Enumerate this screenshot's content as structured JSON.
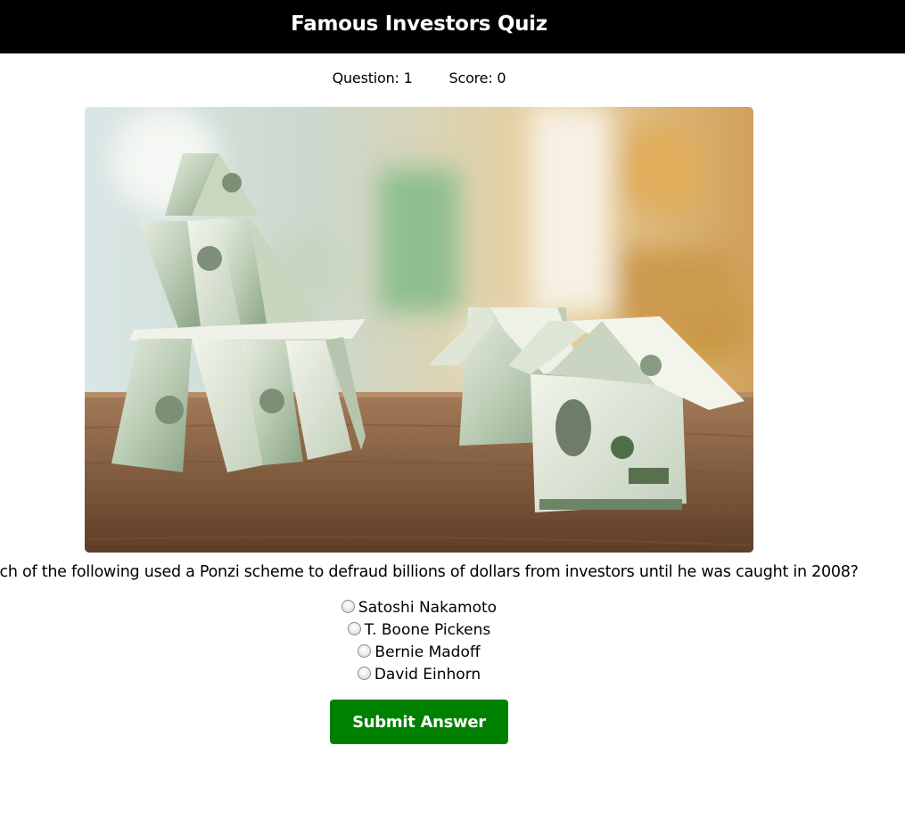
{
  "header": {
    "title": "Famous Investors Quiz"
  },
  "status": {
    "question_label": "Question:",
    "question_number": "1",
    "score_label": "Score:",
    "score": "0"
  },
  "quiz": {
    "question": "Which of the following used a Ponzi scheme to defraud billions of dollars from investors until he was caught in 2008?",
    "options": [
      {
        "label": "Satoshi Nakamoto"
      },
      {
        "label": "T. Boone Pickens"
      },
      {
        "label": "Bernie Madoff"
      },
      {
        "label": "David Einhorn"
      }
    ],
    "submit_label": "Submit Answer"
  },
  "image": {
    "subject": "houses-made-of-dollar-bills"
  },
  "colors": {
    "header_bg": "#000000",
    "submit_bg": "#008000"
  }
}
